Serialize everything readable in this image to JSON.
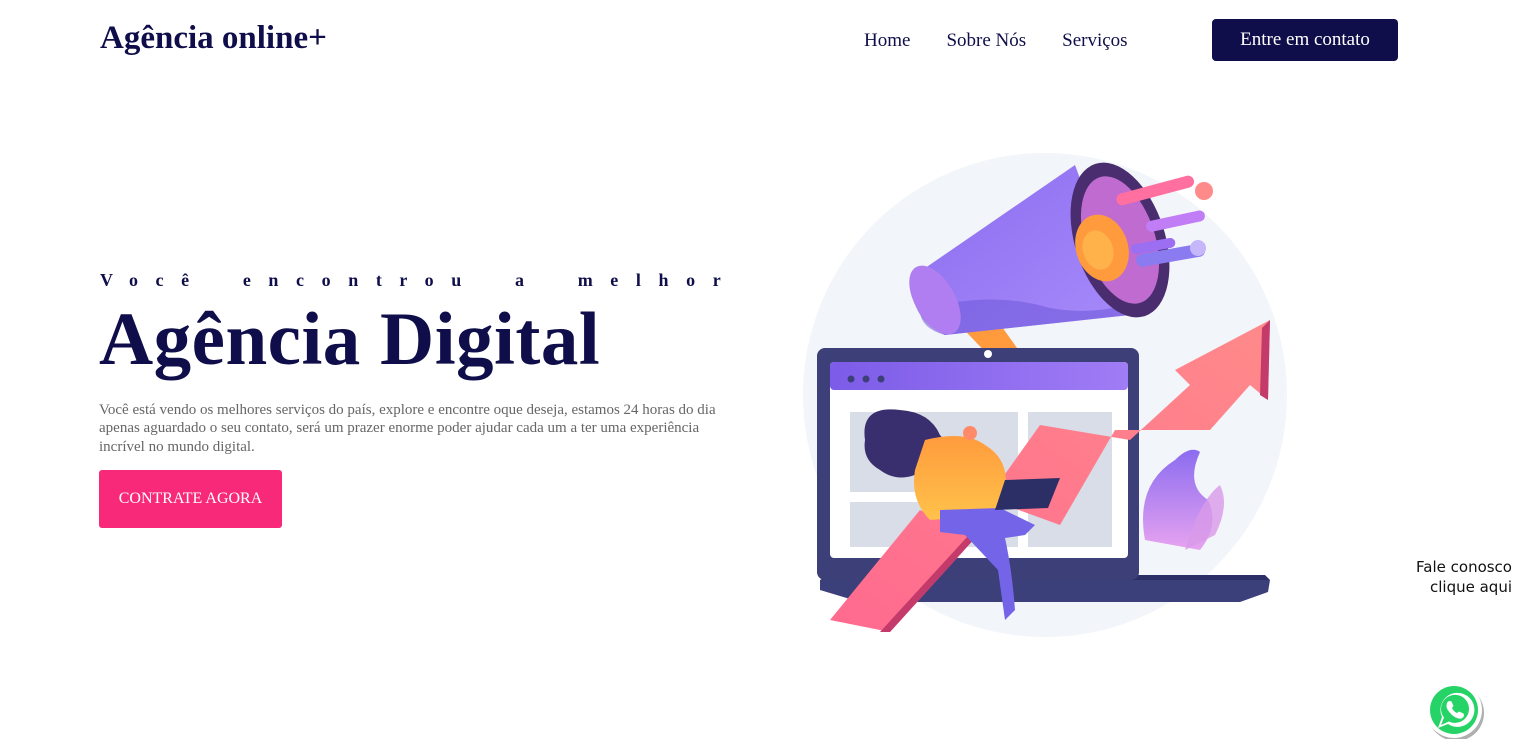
{
  "header": {
    "logo": "Agência online+",
    "nav": [
      "Home",
      "Sobre Nós",
      "Serviços"
    ],
    "contact_button": "Entre em contato"
  },
  "hero": {
    "kicker": "Você encontrou a melhor",
    "title": "Agência Digital",
    "description": "Você está vendo os melhores serviços do país, explore e encontre oque deseja, estamos 24 horas do dia apenas aguardado o seu contato, será um prazer enorme poder ajudar cada um a ter uma experiência incrível no mundo digital.",
    "cta": "CONTRATE AGORA"
  },
  "float_contact": {
    "line1": "Fale conosco",
    "line2": "clique aqui"
  },
  "icons": {
    "chat": "whatsapp-icon",
    "hero_art": "megaphone-laptop-illustration"
  },
  "colors": {
    "navy": "#0f0e4a",
    "pink": "#f72978",
    "text_gray": "#666666",
    "whatsapp_green": "#25d366"
  }
}
